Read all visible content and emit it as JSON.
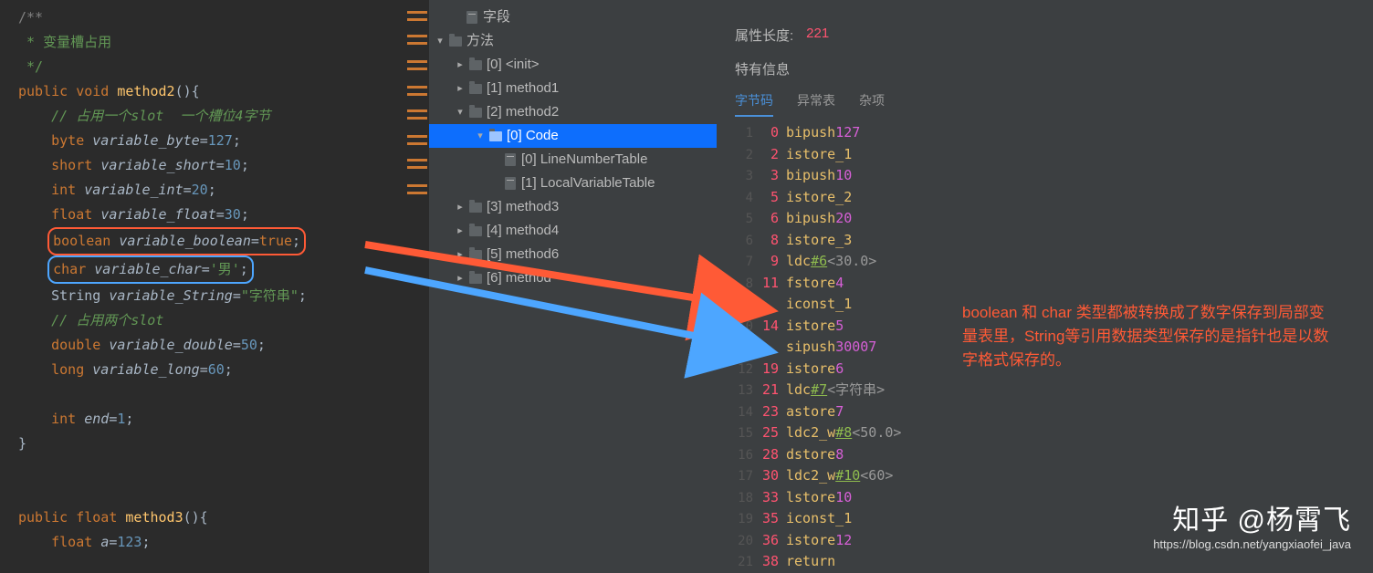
{
  "editor": {
    "doc1": "/**",
    "doc2": " * 变量槽占用",
    "doc3": " */",
    "sig": {
      "kw1": "public",
      "kw2": "void",
      "name": "method2",
      "paren": "(){"
    },
    "c1": "// 占用一个slot  一个槽位4字节",
    "l_byte": {
      "type": "byte",
      "name": "variable_byte",
      "val": "127"
    },
    "l_short": {
      "type": "short",
      "name": "variable_short",
      "val": "10"
    },
    "l_int": {
      "type": "int",
      "name": "variable_int",
      "val": "20"
    },
    "l_float": {
      "type": "float",
      "name": "variable_float",
      "val": "30"
    },
    "l_bool": {
      "type": "boolean",
      "name": "variable_boolean",
      "val": "true"
    },
    "l_char": {
      "type": "char",
      "name": "variable_char",
      "val": "'男'"
    },
    "l_string": {
      "type": "String",
      "name": "variable_String",
      "val": "\"字符串\""
    },
    "c2": "// 占用两个slot",
    "l_double": {
      "type": "double",
      "name": "variable_double",
      "val": "50"
    },
    "l_long": {
      "type": "long",
      "name": "variable_long",
      "val": "60"
    },
    "l_end": {
      "type": "int",
      "name": "end",
      "val": "1"
    },
    "close": "}",
    "sig3": {
      "kw1": "public",
      "kw2": "float",
      "name": "method3",
      "paren": "(){"
    },
    "l_a": {
      "type": "float",
      "name": "a",
      "val": "123"
    }
  },
  "tree": {
    "item_fields": "字段",
    "item_methods": "方法",
    "item_init": "[0] <init>",
    "item_m1": "[1] method1",
    "item_m2": "[2] method2",
    "item_code": "[0] Code",
    "item_lnt": "[0] LineNumberTable",
    "item_lvt": "[1] LocalVariableTable",
    "item_m3": "[3] method3",
    "item_m4": "[4] method4",
    "item_m6": "[5] method6",
    "item_m6b": "[6] method"
  },
  "right": {
    "prop_len_label": "属性长度:",
    "prop_len_val": "221",
    "section": "特有信息",
    "tabs": {
      "bc": "字节码",
      "ex": "异常表",
      "misc": "杂项"
    }
  },
  "bytecode": [
    {
      "ln": "1",
      "off": "0",
      "op": "bipush",
      "arg": "127",
      "style": "mag"
    },
    {
      "ln": "2",
      "off": "2",
      "op": "istore_1"
    },
    {
      "ln": "3",
      "off": "3",
      "op": "bipush",
      "arg": "10",
      "style": "mag"
    },
    {
      "ln": "4",
      "off": "5",
      "op": "istore_2"
    },
    {
      "ln": "5",
      "off": "6",
      "op": "bipush",
      "arg": "20",
      "style": "mag"
    },
    {
      "ln": "6",
      "off": "8",
      "op": "istore_3"
    },
    {
      "ln": "7",
      "off": "9",
      "op": "ldc",
      "arg": "#6",
      "style": "green",
      "cmt": "<30.0>"
    },
    {
      "ln": "8",
      "off": "11",
      "op": "fstore",
      "arg": "4",
      "style": "mag"
    },
    {
      "ln": "9",
      "off": "",
      "op": "iconst_1"
    },
    {
      "ln": "10",
      "off": "14",
      "op": "istore",
      "arg": "5",
      "style": "mag"
    },
    {
      "ln": "11",
      "off": "",
      "op": "sipush",
      "arg": "30007",
      "style": "mag"
    },
    {
      "ln": "12",
      "off": "19",
      "op": "istore",
      "arg": "6",
      "style": "mag"
    },
    {
      "ln": "13",
      "off": "21",
      "op": "ldc",
      "arg": "#7",
      "style": "green",
      "cmt": "<字符串>"
    },
    {
      "ln": "14",
      "off": "23",
      "op": "astore",
      "arg": "7",
      "style": "mag"
    },
    {
      "ln": "15",
      "off": "25",
      "op": "ldc2_w",
      "arg": "#8",
      "style": "green",
      "cmt": "<50.0>"
    },
    {
      "ln": "16",
      "off": "28",
      "op": "dstore",
      "arg": "8",
      "style": "mag"
    },
    {
      "ln": "17",
      "off": "30",
      "op": "ldc2_w",
      "arg": "#10",
      "style": "green",
      "cmt": "<60>"
    },
    {
      "ln": "18",
      "off": "33",
      "op": "lstore",
      "arg": "10",
      "style": "mag"
    },
    {
      "ln": "19",
      "off": "35",
      "op": "iconst_1"
    },
    {
      "ln": "20",
      "off": "36",
      "op": "istore",
      "arg": "12",
      "style": "mag"
    },
    {
      "ln": "21",
      "off": "38",
      "op": "return"
    }
  ],
  "annotation": "boolean 和 char 类型都被转换成了数字保存到局部变量表里，String等引用数据类型保存的是指针也是以数字格式保存的。",
  "watermark": {
    "big": "知乎 @杨霄飞",
    "url": "https://blog.csdn.net/yangxiaofei_java"
  }
}
